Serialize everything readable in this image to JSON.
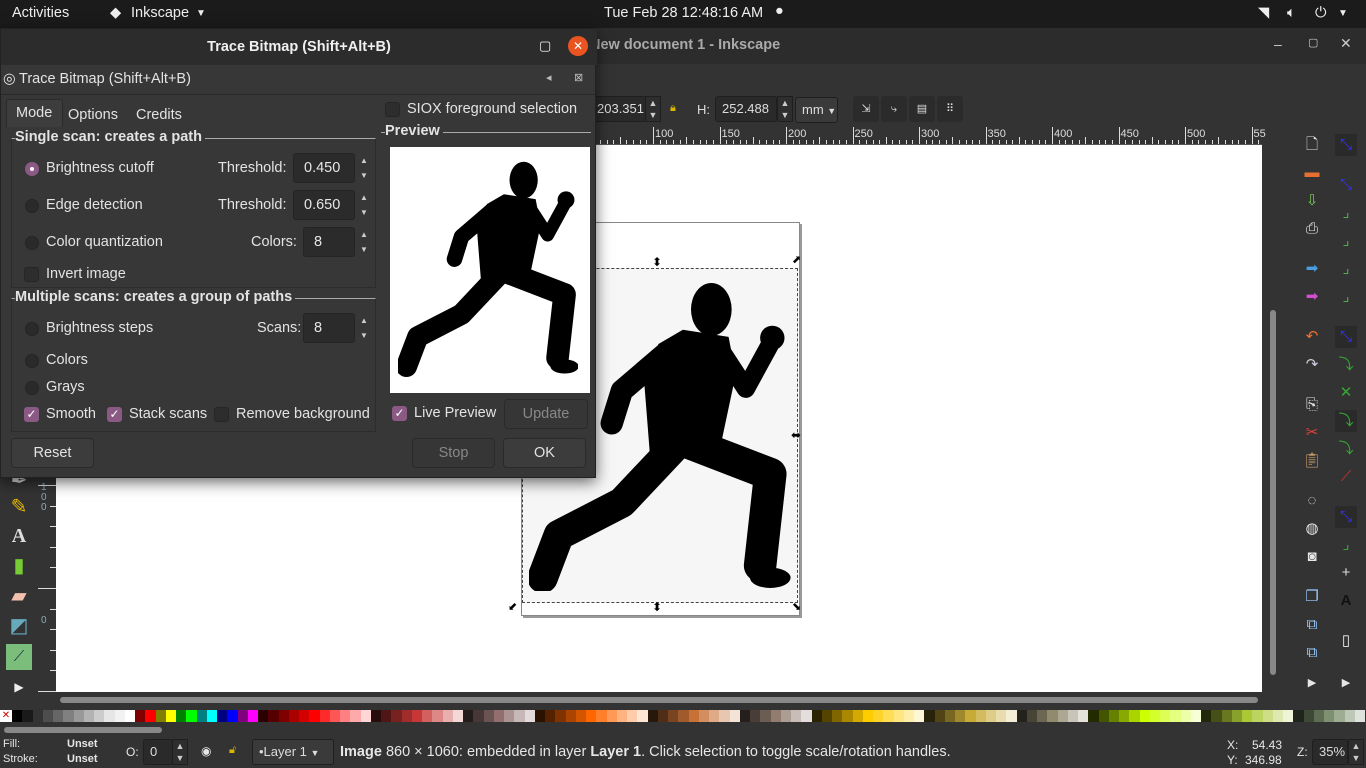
{
  "topbar": {
    "activities": "Activities",
    "app": "Inkscape",
    "clock": "Tue Feb 28  12:48:16 AM"
  },
  "window": {
    "title": "New document 1 - Inkscape"
  },
  "controls": {
    "w_value": "203.351",
    "h_label": "H:",
    "h_value": "252.488",
    "unit": "mm"
  },
  "ruler": {
    "h_ticks": [
      "100",
      "150",
      "200",
      "250",
      "300",
      "350",
      "400",
      "450",
      "500",
      "55"
    ],
    "v_ticks": [
      "1",
      "0",
      "0",
      "0"
    ]
  },
  "dialog": {
    "title": "Trace Bitmap (Shift+Alt+B)",
    "panel_title": "Trace Bitmap (Shift+Alt+B)",
    "tabs": [
      {
        "label": "Mode",
        "active": true
      },
      {
        "label": "Options"
      },
      {
        "label": "Credits"
      }
    ],
    "siox": {
      "label": "SIOX foreground selection",
      "checked": false
    },
    "single_scan": {
      "title": "Single scan: creates a path",
      "brightness": {
        "label": "Brightness cutoff",
        "selected": true,
        "param_label": "Threshold:",
        "value": "0.450"
      },
      "edge": {
        "label": "Edge detection",
        "param_label": "Threshold:",
        "value": "0.650"
      },
      "colorq": {
        "label": "Color quantization",
        "param_label": "Colors:",
        "value": "8"
      },
      "invert": {
        "label": "Invert image",
        "checked": false
      }
    },
    "multi_scan": {
      "title": "Multiple scans: creates a group of paths",
      "steps": {
        "label": "Brightness steps",
        "param_label": "Scans:",
        "value": "8"
      },
      "colors": {
        "label": "Colors"
      },
      "grays": {
        "label": "Grays"
      },
      "smooth": {
        "label": "Smooth",
        "checked": true
      },
      "stack": {
        "label": "Stack scans",
        "checked": true
      },
      "remove_bg": {
        "label": "Remove background",
        "checked": false
      }
    },
    "preview": {
      "title": "Preview",
      "live_label": "Live Preview",
      "live_checked": true,
      "update": "Update"
    },
    "buttons": {
      "reset": "Reset",
      "stop": "Stop",
      "ok": "OK"
    }
  },
  "palette": [
    "#000000",
    "#1a1a1a",
    "#333333",
    "#4d4d4d",
    "#666666",
    "#808080",
    "#999999",
    "#b3b3b3",
    "#cccccc",
    "#e6e6e6",
    "#f2f2f2",
    "#ffffff",
    "#800000",
    "#ff0000",
    "#808000",
    "#ffff00",
    "#008000",
    "#00ff00",
    "#008080",
    "#00ffff",
    "#000080",
    "#0000ff",
    "#800080",
    "#ff00ff",
    "#2b0000",
    "#550000",
    "#800000",
    "#aa0000",
    "#d40000",
    "#ff0000",
    "#ff2a2a",
    "#ff5555",
    "#ff8080",
    "#ffaaaa",
    "#ffd5d5",
    "#280b0b",
    "#501616",
    "#782121",
    "#a02c2c",
    "#c83737",
    "#d35f5f",
    "#de8787",
    "#e9afaf",
    "#f4d7d7",
    "#241c1c",
    "#483737",
    "#6c5353",
    "#916f6f",
    "#ac9393",
    "#c8b7b7",
    "#e3dbdb",
    "#2b1100",
    "#552200",
    "#803300",
    "#aa4400",
    "#d45500",
    "#ff6600",
    "#ff7f2a",
    "#ff9955",
    "#ffb380",
    "#ffccaa",
    "#ffe6d5",
    "#28170b",
    "#502d16",
    "#784421",
    "#a05a2c",
    "#c87137",
    "#d38d5f",
    "#deaa87",
    "#e9c6af",
    "#f4e3d7",
    "#241f1c",
    "#483e37",
    "#6c5d53",
    "#917c6f",
    "#ac9d93",
    "#c8beb7",
    "#e3dedb",
    "#2b2200",
    "#554400",
    "#806600",
    "#aa8800",
    "#d4aa00",
    "#ffcc00",
    "#ffd42a",
    "#ffdd55",
    "#ffe680",
    "#ffeeaa",
    "#fff6d5",
    "#28220b",
    "#504416",
    "#786721",
    "#a0892c",
    "#c8ab37",
    "#d3bc5f",
    "#decd87",
    "#e9ddaf",
    "#f4eed7",
    "#24221c",
    "#484537",
    "#6c6753",
    "#918a6f",
    "#aca793",
    "#c8c4b7",
    "#e3e2db",
    "#222b00",
    "#445500",
    "#668000",
    "#88aa00",
    "#aad400",
    "#ccff00",
    "#d4ff2a",
    "#ddff55",
    "#e5ff80",
    "#eeffaa",
    "#f6ffd5",
    "#22280b",
    "#445016",
    "#677821",
    "#89a02c",
    "#abc837",
    "#bcd35f",
    "#cdde87",
    "#dde9af",
    "#eef4d7",
    "#1f241c",
    "#3e4837",
    "#5d6c53",
    "#7c916f",
    "#9dac93",
    "#bec8b7",
    "#dee3db"
  ],
  "status": {
    "fill_label": "Fill:",
    "fill_value": "Unset",
    "stroke_label": "Stroke:",
    "stroke_value": "Unset",
    "opacity_label": "O:",
    "opacity_value": "0",
    "layer": "•Layer 1",
    "msg_bold1": "Image",
    "msg1": " 860 × 1060: embedded in layer ",
    "msg_bold2": "Layer 1",
    "msg2": ". Click selection to toggle scale/rotation handles.",
    "x_label": "X:",
    "x_value": "54.43",
    "y_label": "Y:",
    "y_value": "346.98",
    "z_label": "Z:",
    "zoom": "35%"
  }
}
